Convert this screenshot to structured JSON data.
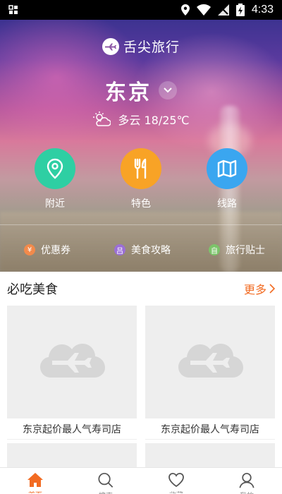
{
  "status_bar": {
    "time": "4:33"
  },
  "brand": {
    "name": "舌尖旅行"
  },
  "city": {
    "name": "东京"
  },
  "weather": {
    "text": "多云 18/25℃"
  },
  "quick_nav": [
    {
      "label": "附近",
      "icon": "location-pin-icon",
      "color": "#2ecfa3"
    },
    {
      "label": "特色",
      "icon": "fork-knife-icon",
      "color": "#f8a326"
    },
    {
      "label": "线路",
      "icon": "map-icon",
      "color": "#3aa6f0"
    }
  ],
  "sub_links": [
    {
      "label": "优惠券",
      "icon": "yen-icon",
      "glyph": "¥",
      "color": "#f28a4b"
    },
    {
      "label": "美食攻略",
      "icon": "guide-icon",
      "glyph": "吕",
      "color": "#9b6fd6"
    },
    {
      "label": "旅行贴士",
      "icon": "tips-icon",
      "glyph": "自",
      "color": "#7cc46a"
    }
  ],
  "section": {
    "title": "必吃美食",
    "more": "更多"
  },
  "cards": [
    {
      "caption": "东京起价最人气寿司店"
    },
    {
      "caption": "东京起价最人气寿司店"
    }
  ],
  "tabbar": [
    {
      "label": "首页",
      "icon": "home-icon",
      "active": true
    },
    {
      "label": "搜索",
      "icon": "search-icon",
      "active": false
    },
    {
      "label": "收藏",
      "icon": "heart-icon",
      "active": false
    },
    {
      "label": "我的",
      "icon": "user-icon",
      "active": false
    }
  ],
  "colors": {
    "accent": "#f26b22",
    "placeholder": "#eeeeee"
  }
}
